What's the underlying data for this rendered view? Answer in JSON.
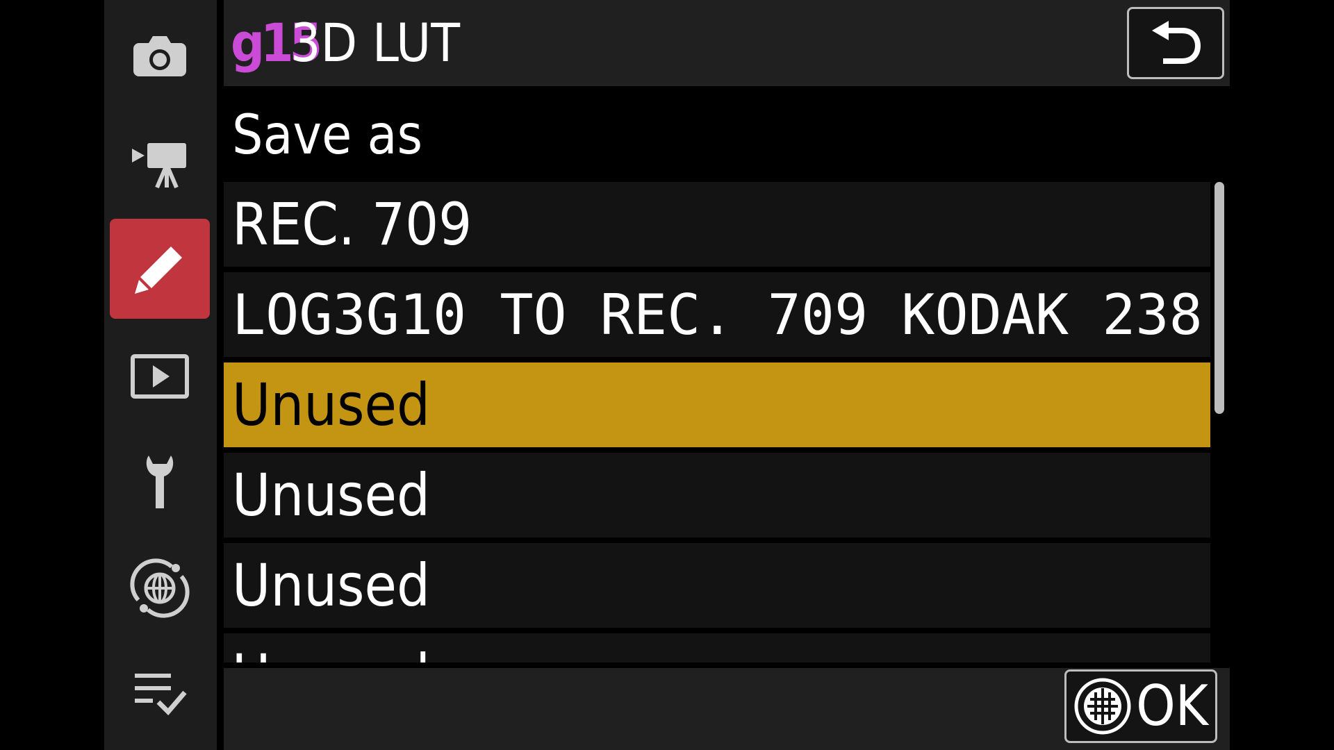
{
  "sidebar": {
    "items": [
      {
        "icon": "photo-shooting-camera-icon"
      },
      {
        "icon": "video-recording-icon"
      },
      {
        "icon": "custom-settings-pencil-icon",
        "active": true
      },
      {
        "icon": "playback-icon"
      },
      {
        "icon": "setup-wrench-icon"
      },
      {
        "icon": "network-globe-icon"
      },
      {
        "icon": "my-menu-checklist-icon"
      }
    ],
    "active_color": "#c0353e"
  },
  "header": {
    "code": "g15",
    "title": "3D LUT",
    "code_color": "#c94bd6",
    "back_icon": "return-arrow-icon"
  },
  "subtitle": "Save as",
  "list": {
    "items": [
      {
        "label": "REC. 709",
        "selected": false
      },
      {
        "label": "LOG3G10 TO REC. 709 KODAK 238···",
        "selected": false
      },
      {
        "label": "Unused",
        "selected": true
      },
      {
        "label": "Unused",
        "selected": false
      },
      {
        "label": "Unused",
        "selected": false
      },
      {
        "label": "Unused",
        "selected": false
      }
    ],
    "selected_color": "#c39512"
  },
  "footer": {
    "ok_icon": "multi-selector-center-icon",
    "ok_label": "OK"
  }
}
